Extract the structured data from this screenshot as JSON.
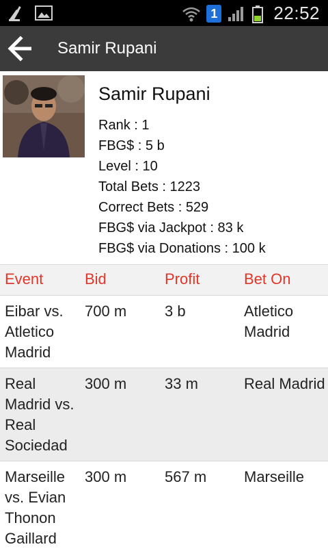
{
  "status_bar": {
    "time": "22:52",
    "notification_count": "1",
    "icons": [
      "cleanup-icon",
      "gallery-icon",
      "wifi-icon",
      "notification-badge",
      "signal-icon",
      "battery-icon"
    ]
  },
  "action_bar": {
    "title": "Samir Rupani",
    "back_icon": "arrow-left-icon"
  },
  "profile": {
    "name": "Samir Rupani",
    "stats": [
      "Rank : 1",
      "FBG$ : 5 b",
      "Level : 10",
      "Total Bets : 1223",
      "Correct Bets : 529",
      "FBG$ via Jackpot : 83 k",
      "FBG$ via Donations : 100 k"
    ]
  },
  "table": {
    "headers": [
      "Event",
      "Bid",
      "Profit",
      "Bet On"
    ],
    "header_color": "#e0362a",
    "rows": [
      {
        "event": "Eibar vs. Atletico Madrid",
        "bid": "700 m",
        "profit": "3 b",
        "bet_on": "Atletico Madrid"
      },
      {
        "event": "Real Madrid vs. Real Sociedad",
        "bid": "300 m",
        "profit": "33 m",
        "bet_on": "Real Madrid"
      },
      {
        "event": "Marseille vs. Evian Thonon Gaillard",
        "bid": "300 m",
        "profit": "567 m",
        "bet_on": "Marseille"
      }
    ]
  }
}
